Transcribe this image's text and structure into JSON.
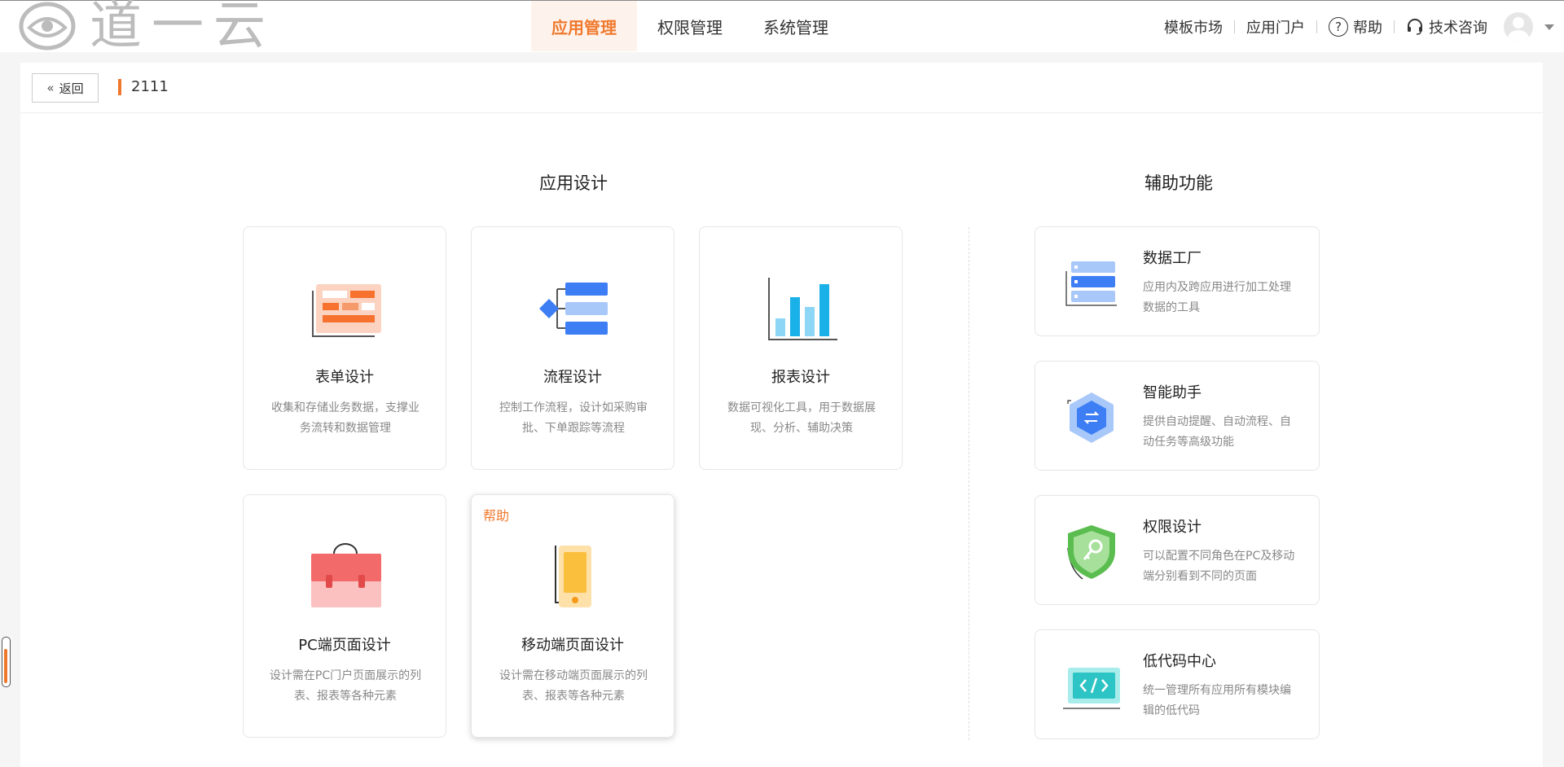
{
  "header": {
    "logo_text": "道一云",
    "nav": [
      {
        "label": "应用管理",
        "active": true
      },
      {
        "label": "权限管理",
        "active": false
      },
      {
        "label": "系统管理",
        "active": false
      }
    ],
    "right": {
      "template_market": "模板市场",
      "app_portal": "应用门户",
      "help": "帮助",
      "tech_support": "技术咨询"
    }
  },
  "subbar": {
    "back_label": "返回",
    "app_name": "2111"
  },
  "sections": {
    "design_title": "应用设计",
    "aux_title": "辅助功能"
  },
  "design_cards": [
    {
      "title": "表单设计",
      "desc": "收集和存储业务数据，支撑业务流转和数据管理"
    },
    {
      "title": "流程设计",
      "desc": "控制工作流程，设计如采购审批、下单跟踪等流程"
    },
    {
      "title": "报表设计",
      "desc": "数据可视化工具，用于数据展现、分析、辅助决策"
    },
    {
      "title": "PC端页面设计",
      "desc": "设计需在PC门户页面展示的列表、报表等各种元素"
    },
    {
      "title": "移动端页面设计",
      "desc": "设计需在移动端页面展示的列表、报表等各种元素",
      "tag": "帮助"
    }
  ],
  "aux_cards": [
    {
      "title": "数据工厂",
      "desc": "应用内及跨应用进行加工处理数据的工具"
    },
    {
      "title": "智能助手",
      "desc": "提供自动提醒、自动流程、自动任务等高级功能"
    },
    {
      "title": "权限设计",
      "desc": "可以配置不同角色在PC及移动端分别看到不同的页面"
    },
    {
      "title": "低代码中心",
      "desc": "统一管理所有应用所有模块编辑的低代码"
    }
  ],
  "colors": {
    "accent": "#f0782d",
    "blue": "#3d7ef5",
    "cyan": "#1ab0e8",
    "red": "#f26a6a",
    "yellow": "#fbbf3e",
    "green": "#5bbd4f"
  }
}
